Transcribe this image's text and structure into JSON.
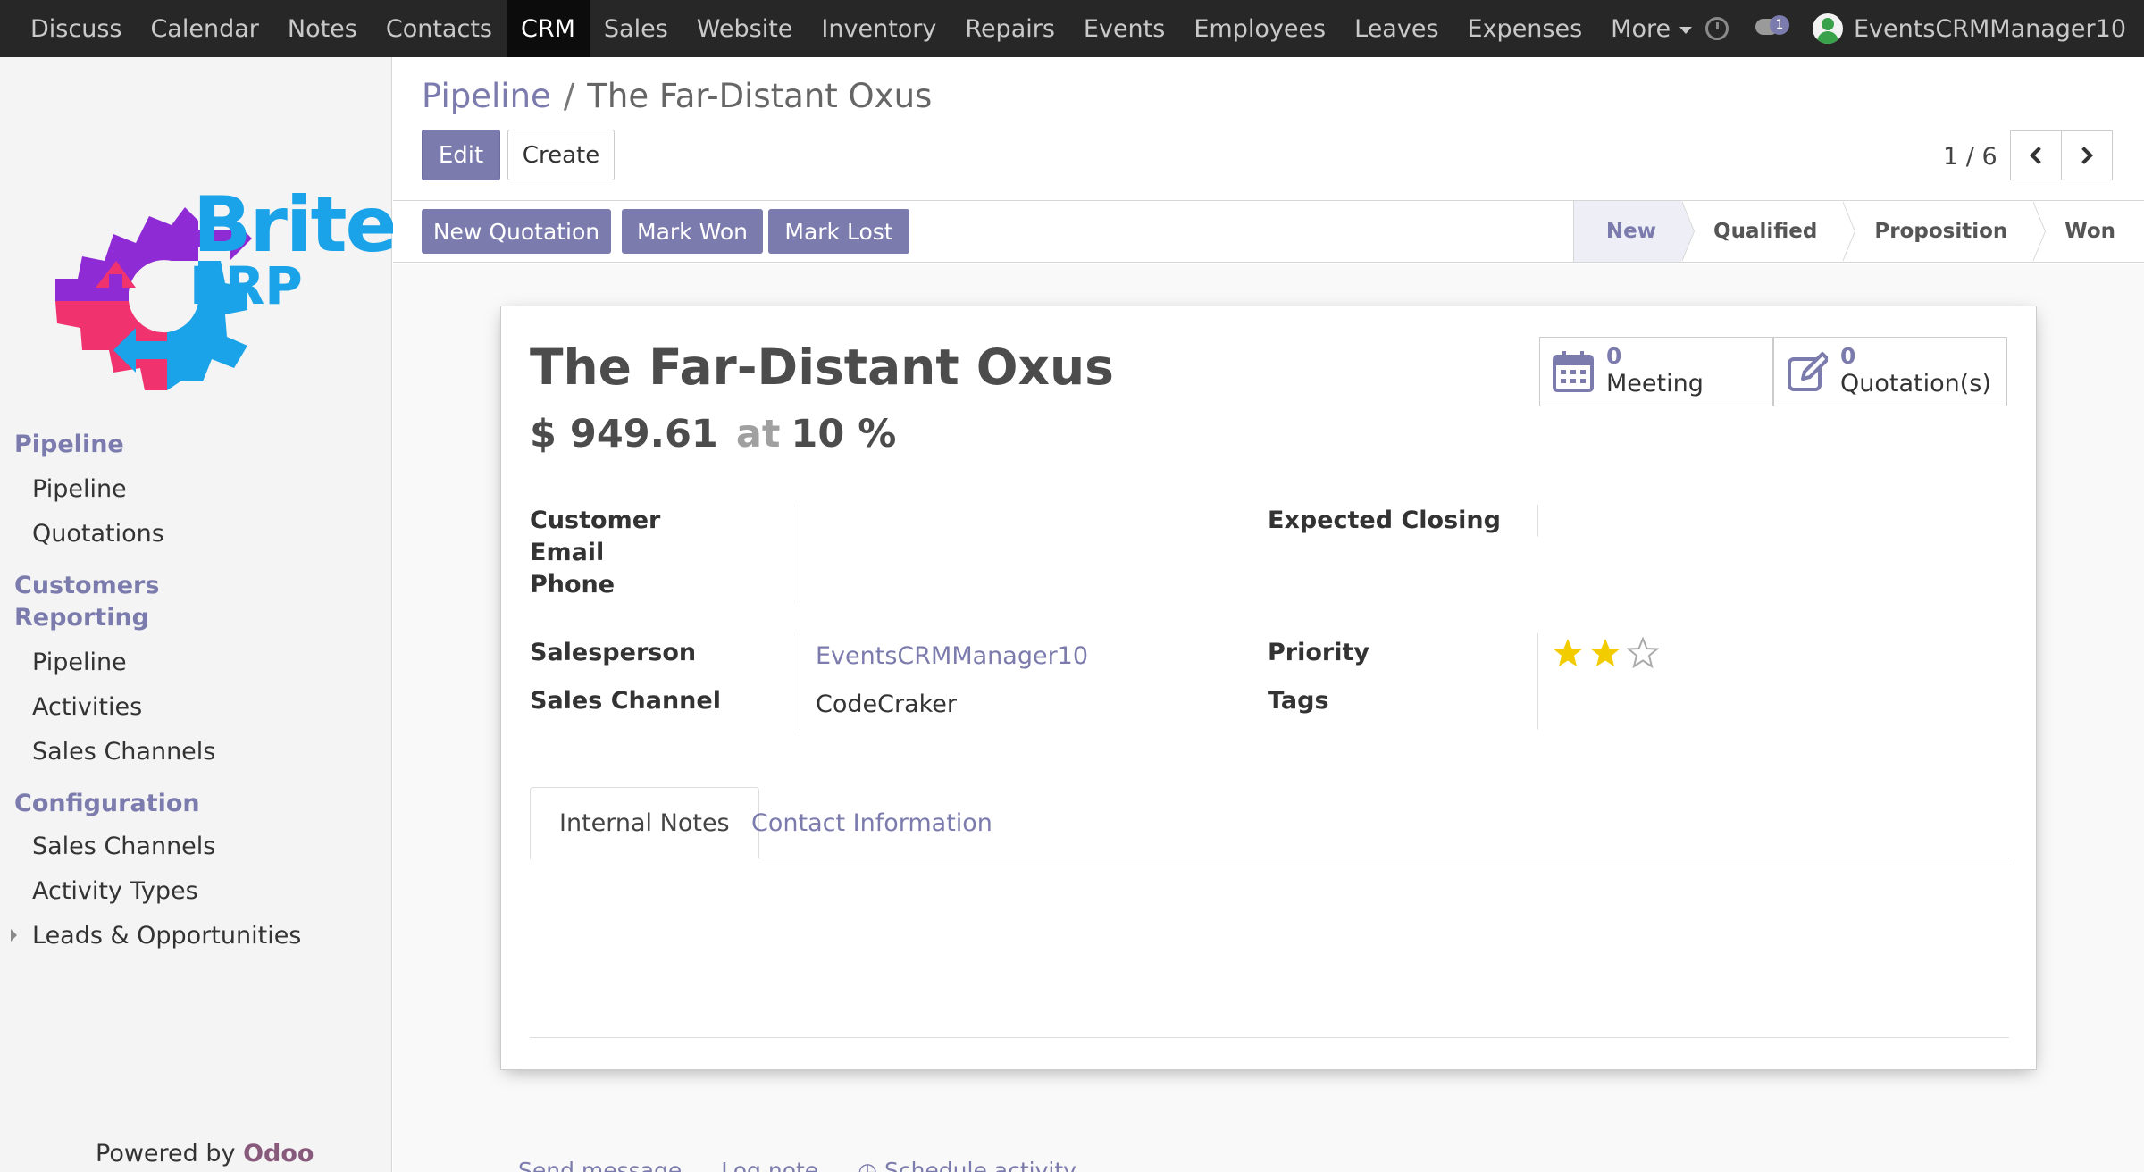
{
  "navbar": {
    "apps": [
      "Discuss",
      "Calendar",
      "Notes",
      "Contacts",
      "CRM",
      "Sales",
      "Website",
      "Inventory",
      "Repairs",
      "Events",
      "Employees",
      "Leaves",
      "Expenses",
      "More"
    ],
    "active_app": "CRM",
    "messages_badge": "1",
    "user_name": "EventsCRMManager10",
    "icons": [
      "clock-icon",
      "chat-icon",
      "avatar"
    ]
  },
  "sidebar": {
    "logo_text_brite": "Brite",
    "logo_text_erp": "ERP",
    "sections": [
      {
        "title": "Pipeline",
        "items": [
          "Pipeline",
          "Quotations"
        ]
      },
      {
        "title": "Customers",
        "items": []
      },
      {
        "title": "Reporting",
        "items": [
          "Pipeline",
          "Activities",
          "Sales Channels"
        ]
      },
      {
        "title": "Configuration",
        "items": [
          "Sales Channels",
          "Activity Types",
          "Leads & Opportunities"
        ]
      }
    ],
    "powered_by": "Powered by",
    "powered_brand": "Odoo"
  },
  "header": {
    "breadcrumb_parent": "Pipeline",
    "breadcrumb_sep": "/",
    "breadcrumb_current": "The Far-Distant Oxus",
    "edit_label": "Edit",
    "create_label": "Create",
    "pager": "1 / 6"
  },
  "statusbar": {
    "actions": [
      "New Quotation",
      "Mark Won",
      "Mark Lost"
    ],
    "stages": [
      "New",
      "Qualified",
      "Proposition",
      "Won"
    ],
    "current_stage": "New"
  },
  "record": {
    "title": "The Far-Distant Oxus",
    "currency": "$",
    "expected_revenue": "949.61",
    "at_label": "at",
    "probability": "10 %",
    "stat_buttons": [
      {
        "count": "0",
        "label": "Meeting",
        "icon": "calendar-icon"
      },
      {
        "count": "0",
        "label": "Quotation(s)",
        "icon": "edit-icon"
      }
    ],
    "labels": {
      "customer": "Customer",
      "email": "Email",
      "phone": "Phone",
      "expected_closing": "Expected Closing",
      "salesperson": "Salesperson",
      "sales_channel": "Sales Channel",
      "priority": "Priority",
      "tags": "Tags"
    },
    "values": {
      "salesperson": "EventsCRMManager10",
      "sales_channel": "CodeCraker"
    },
    "priority_stars": 2,
    "priority_max": 3,
    "tabs": [
      "Internal Notes",
      "Contact Information"
    ],
    "active_tab": "Internal Notes"
  },
  "chatter": {
    "actions": [
      "Send message",
      "Log note",
      "Schedule activity"
    ]
  },
  "colors": {
    "accent": "#7c7bad",
    "navbar": "#272727",
    "star_on": "#f3cc00",
    "logo_blue": "#1aa3e8",
    "logo_purple": "#8e2bd4",
    "logo_pink": "#f0336f"
  }
}
